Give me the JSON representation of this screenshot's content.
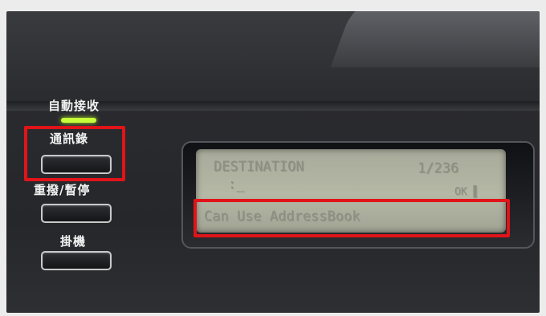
{
  "panel": {
    "buttons": [
      {
        "label": "自動接收"
      },
      {
        "label": "通訊錄"
      },
      {
        "label": "重撥/暫停"
      },
      {
        "label": "掛機"
      }
    ],
    "led_color": "#c6ff3a"
  },
  "lcd": {
    "line1_left": "DESTINATION",
    "line1_right": "1/236",
    "line2": ":_",
    "line2_right": "OK ▌",
    "line3": "Can Use AddressBook"
  },
  "highlight_color": "#e01419"
}
